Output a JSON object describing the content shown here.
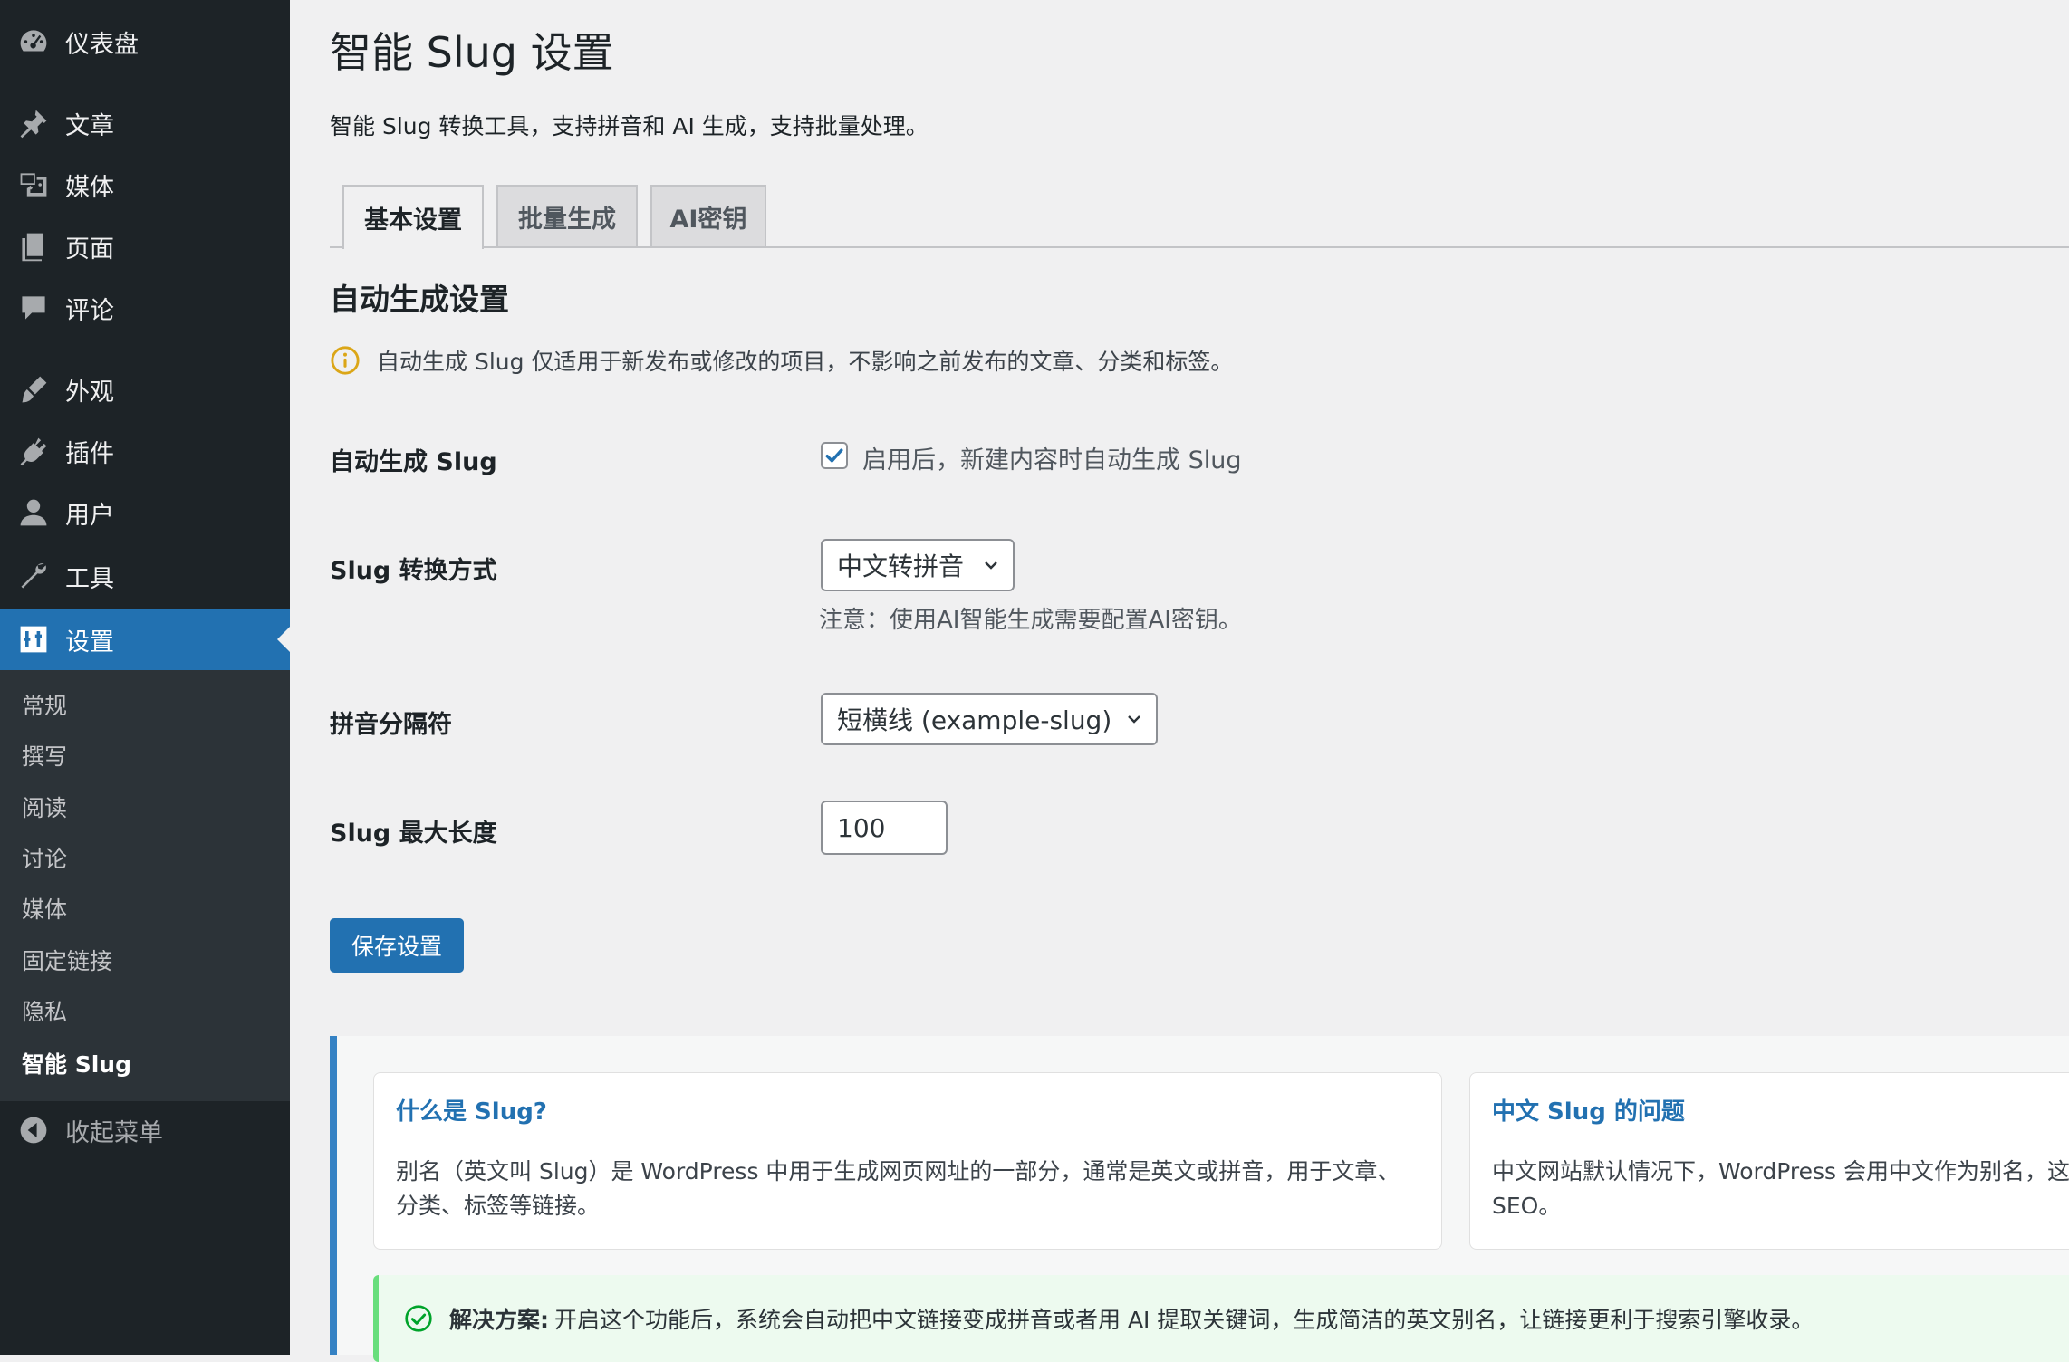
{
  "sidebar": {
    "items": [
      {
        "label": "仪表盘",
        "icon": "dashboard-icon"
      },
      {
        "label": "文章",
        "icon": "pin-icon"
      },
      {
        "label": "媒体",
        "icon": "media-icon"
      },
      {
        "label": "页面",
        "icon": "pages-icon"
      },
      {
        "label": "评论",
        "icon": "comments-icon"
      },
      {
        "label": "外观",
        "icon": "appearance-icon"
      },
      {
        "label": "插件",
        "icon": "plugins-icon"
      },
      {
        "label": "用户",
        "icon": "users-icon"
      },
      {
        "label": "工具",
        "icon": "tools-icon"
      },
      {
        "label": "设置",
        "icon": "settings-icon",
        "active": true
      }
    ],
    "submenu": [
      "常规",
      "撰写",
      "阅读",
      "讨论",
      "媒体",
      "固定链接",
      "隐私",
      "智能 Slug"
    ],
    "submenu_current": "智能 Slug",
    "collapse_label": "收起菜单"
  },
  "page": {
    "title": "智能 Slug 设置",
    "description": "智能 Slug 转换工具，支持拼音和 AI 生成，支持批量处理。"
  },
  "tabs": [
    {
      "label": "基本设置",
      "active": true
    },
    {
      "label": "批量生成",
      "active": false
    },
    {
      "label": "AI密钥",
      "active": false
    }
  ],
  "section": {
    "title": "自动生成设置",
    "notice": "自动生成 Slug 仅适用于新发布或修改的项目，不影响之前发布的文章、分类和标签。"
  },
  "form": {
    "auto_slug": {
      "label": "自动生成 Slug",
      "checked": true,
      "checkbox_label": "启用后，新建内容时自动生成 Slug"
    },
    "method": {
      "label": "Slug 转换方式",
      "selected": "中文转拼音",
      "hint": "注意：使用AI智能生成需要配置AI密钥。"
    },
    "separator": {
      "label": "拼音分隔符",
      "selected": "短横线 (example-slug)"
    },
    "max_length": {
      "label": "Slug 最大长度",
      "value": "100"
    },
    "save_label": "保存设置"
  },
  "info": {
    "cards": [
      {
        "title": "什么是 Slug?",
        "body": "别名（英文叫 Slug）是 WordPress 中用于生成网页网址的一部分，通常是英文或拼音，用于文章、分类、标签等链接。"
      },
      {
        "title": "中文 Slug 的问题",
        "body": "中文网站默认情况下，WordPress 会用中文作为别名，这 SEO。"
      }
    ],
    "solution_label": "解决方案:",
    "solution_text": "开启这个功能后，系统会自动把中文链接变成拼音或者用 AI 提取关键词，生成简洁的英文别名，让链接更利于搜索引擎收录。"
  },
  "colors": {
    "accent": "#2271b1",
    "sidebar_bg": "#1d2327",
    "submenu_bg": "#2c3338",
    "success": "#68de7c",
    "warning": "#d63638"
  }
}
